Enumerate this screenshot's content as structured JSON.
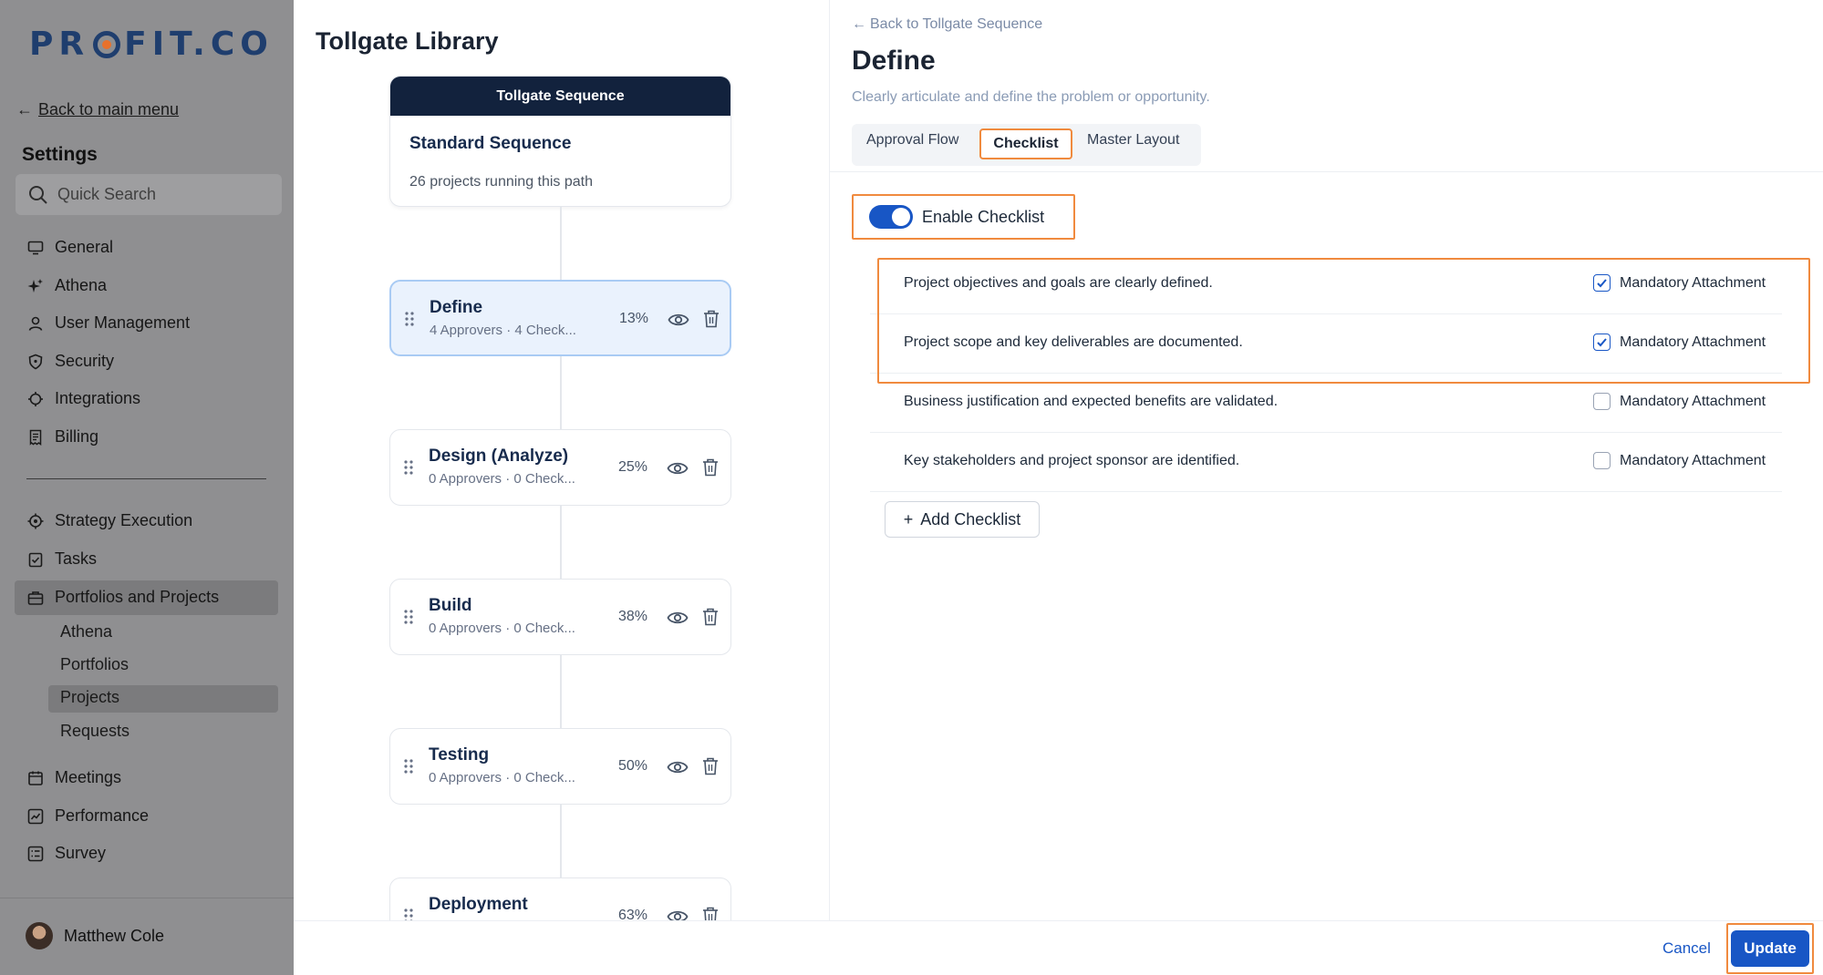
{
  "brand": {
    "logo_text": "PROFIT.CO"
  },
  "sidebar": {
    "back_label": "Back to main menu",
    "settings_title": "Settings",
    "search_placeholder": "Quick Search",
    "nav_top": [
      {
        "label": "General",
        "icon": "monitor-icon"
      },
      {
        "label": "Athena",
        "icon": "sparkle-icon"
      },
      {
        "label": "User Management",
        "icon": "user-icon"
      },
      {
        "label": "Security",
        "icon": "shield-icon"
      },
      {
        "label": "Integrations",
        "icon": "plug-icon"
      },
      {
        "label": "Billing",
        "icon": "receipt-icon"
      }
    ],
    "nav_bottom": [
      {
        "label": "Strategy Execution",
        "icon": "target-icon"
      },
      {
        "label": "Tasks",
        "icon": "clipboard-check-icon"
      },
      {
        "label": "Portfolios and Projects",
        "icon": "briefcase-icon"
      }
    ],
    "sub_items": [
      "Athena",
      "Portfolios",
      "Projects",
      "Requests"
    ],
    "nav_more": [
      {
        "label": "Meetings",
        "icon": "calendar-icon"
      },
      {
        "label": "Performance",
        "icon": "chart-icon"
      },
      {
        "label": "Survey",
        "icon": "survey-icon"
      }
    ],
    "user_name": "Matthew Cole"
  },
  "library": {
    "title": "Tollgate Library",
    "sequence_header": "Tollgate Sequence",
    "sequence_name": "Standard Sequence",
    "sequence_sub": "26 projects running this path",
    "stages": [
      {
        "name": "Define",
        "meta": "4 Approvers · 4 Check...",
        "pct": "13%"
      },
      {
        "name": "Design (Analyze)",
        "meta": "0 Approvers · 0 Check...",
        "pct": "25%"
      },
      {
        "name": "Build",
        "meta": "0 Approvers · 0 Check...",
        "pct": "38%"
      },
      {
        "name": "Testing",
        "meta": "0 Approvers · 0 Check...",
        "pct": "50%"
      },
      {
        "name": "Deployment",
        "meta": "",
        "pct": "63%"
      }
    ]
  },
  "detail": {
    "back_label": "Back to Tollgate Sequence",
    "title": "Define",
    "description": "Clearly articulate and define the problem or opportunity.",
    "tabs": [
      "Approval Flow",
      "Checklist",
      "Master Layout"
    ],
    "enable_label": "Enable Checklist",
    "enable_on": true,
    "checklist": [
      {
        "text": "Project objectives and goals are clearly defined.",
        "label": "Mandatory Attachment",
        "checked": true
      },
      {
        "text": "Project scope and key deliverables are documented.",
        "label": "Mandatory Attachment",
        "checked": true
      },
      {
        "text": "Business justification and expected benefits are validated.",
        "label": "Mandatory Attachment",
        "checked": false
      },
      {
        "text": "Key stakeholders and project sponsor are identified.",
        "label": "Mandatory Attachment",
        "checked": false
      }
    ],
    "add_label": "Add Checklist"
  },
  "footer": {
    "cancel_label": "Cancel",
    "update_label": "Update"
  },
  "colors": {
    "accent": "#1856c5",
    "highlight": "#f08a3e",
    "navy": "#12223d",
    "sidebar_bg": "#8f8f91"
  }
}
